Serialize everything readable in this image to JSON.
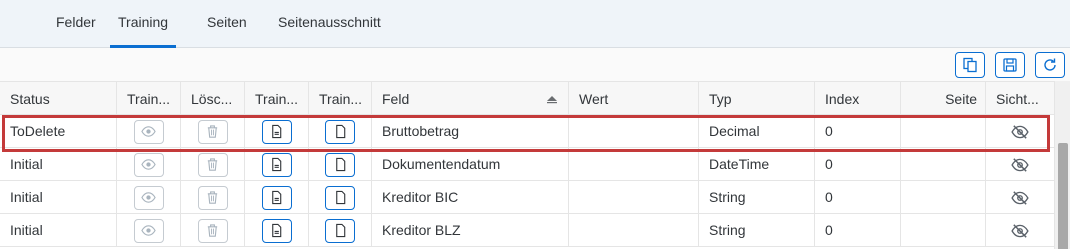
{
  "tabs": [
    {
      "label": "Felder"
    },
    {
      "label": "Training"
    },
    {
      "label": "Seiten"
    },
    {
      "label": "Seitenausschnitt"
    }
  ],
  "active_tab": "Training",
  "toolbar": {
    "copy_icon": "copy-icon",
    "save_icon": "save-icon",
    "refresh_icon": "refresh-icon"
  },
  "table": {
    "columns": [
      "Status",
      "Train...",
      "Lösc...",
      "Train...",
      "Train...",
      "Feld",
      "Wert",
      "Typ",
      "Index",
      "Seite",
      "Sicht..."
    ],
    "rows": [
      {
        "status": "ToDelete",
        "feld": "Bruttobetrag",
        "wert": "",
        "typ": "Decimal",
        "index": "0",
        "seite": ""
      },
      {
        "status": "Initial",
        "feld": "Dokumentendatum",
        "wert": "",
        "typ": "DateTime",
        "index": "0",
        "seite": ""
      },
      {
        "status": "Initial",
        "feld": "Kreditor BIC",
        "wert": "",
        "typ": "String",
        "index": "0",
        "seite": ""
      },
      {
        "status": "Initial",
        "feld": "Kreditor BLZ",
        "wert": "",
        "typ": "String",
        "index": "0",
        "seite": ""
      }
    ]
  },
  "colors": {
    "accent": "#0a6ed1",
    "selection_border": "#c43a3a",
    "tabbar_bg": "#eff4f9"
  }
}
